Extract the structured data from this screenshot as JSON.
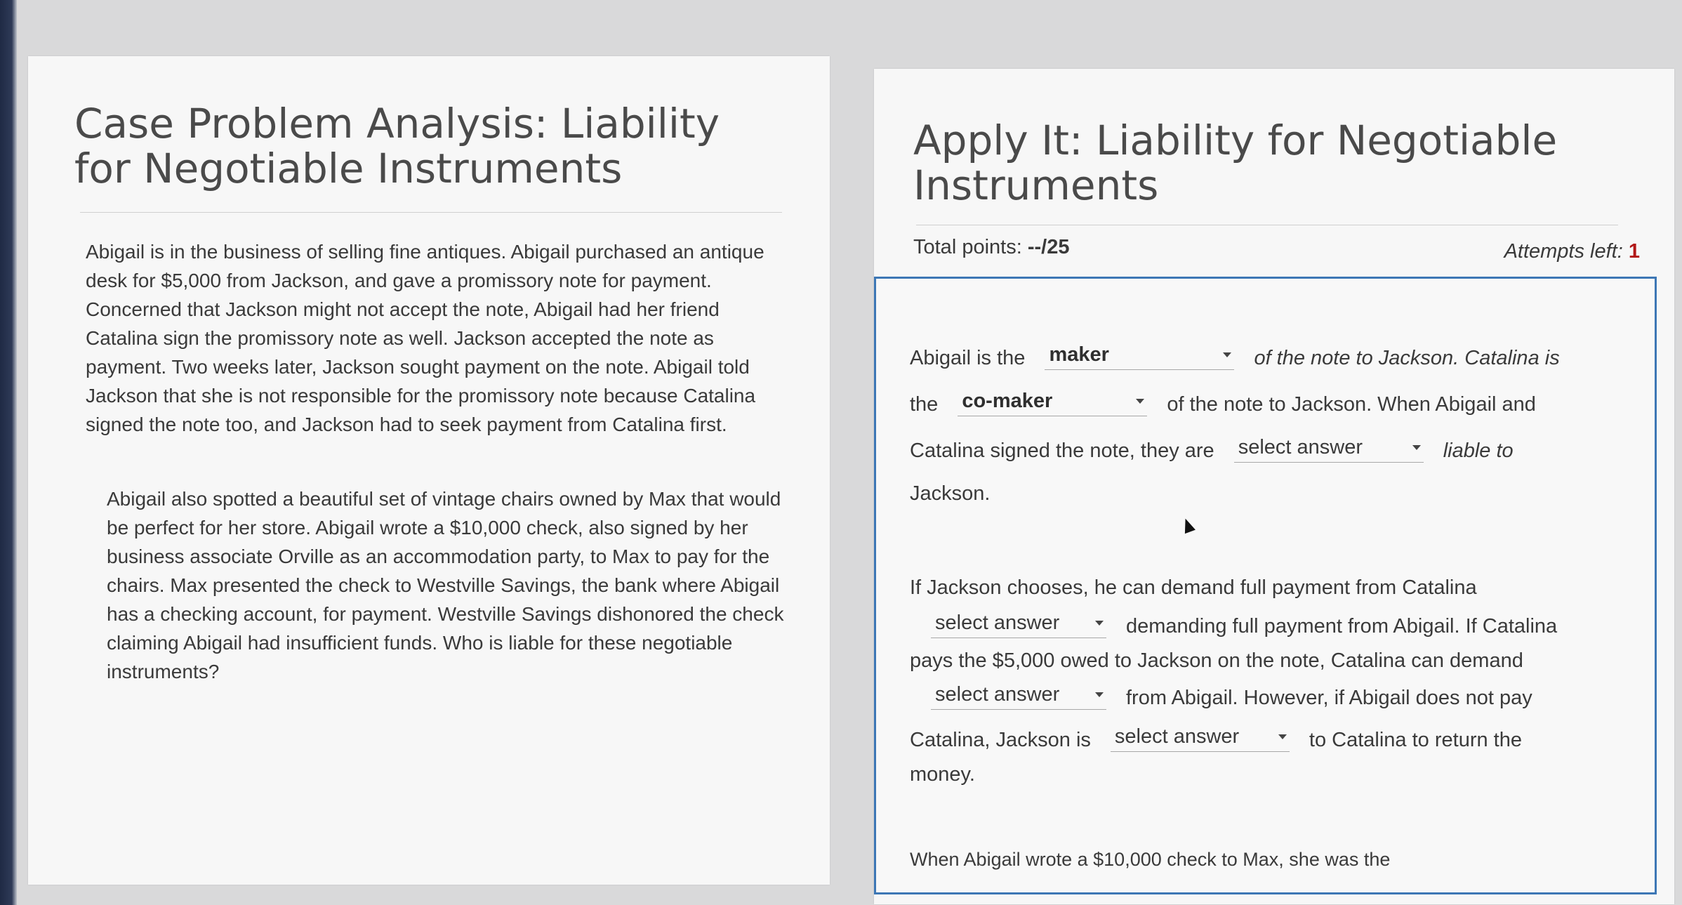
{
  "left_panel": {
    "title": "Case Problem Analysis: Liability for Negotiable Instruments",
    "paragraph_1": "Abigail is in the business of selling fine antiques. Abigail purchased an antique desk for $5,000 from Jackson, and gave a promissory note for payment. Concerned that Jackson might not accept the note, Abigail had her friend Catalina sign the promissory note as well. Jackson accepted the note as payment. Two weeks later, Jackson sought payment on the note. Abigail told Jackson that she is not responsible for the promissory note because Catalina signed the note too, and Jackson had to seek payment from Catalina first.",
    "paragraph_2": "Abigail also spotted a beautiful set of vintage chairs owned by Max that would be perfect for her store. Abigail wrote a $10,000 check, also signed by her business associate Orville as an accommodation party, to Max to pay for the chairs. Max presented the check to Westville Savings, the bank where Abigail has a checking account, for payment. Westville Savings dishonored the check claiming Abigail had insufficient funds. Who is liable for these negotiable instruments?"
  },
  "right_panel": {
    "title": "Apply It: Liability for Negotiable Instruments",
    "total_points_label": "Total points: ",
    "total_points_value": "--/25",
    "attempts_label": "Attempts left: ",
    "attempts_value": "1",
    "q1": {
      "text_1": "Abigail is the",
      "dropdown_1": "maker",
      "text_2": "of the note to Jackson. Catalina is",
      "text_3": "the",
      "dropdown_2": "co-maker",
      "text_4": "of the note to Jackson. When Abigail and",
      "text_5": "Catalina signed the note, they are",
      "dropdown_3": "select answer",
      "text_6": "liable to",
      "text_7": "Jackson."
    },
    "q2": {
      "text_1": "If Jackson chooses, he can demand full payment from Catalina",
      "dropdown_1": "select answer",
      "text_2": "demanding full payment from Abigail. If Catalina",
      "text_3": "pays the $5,000 owed to Jackson on the note, Catalina can demand",
      "dropdown_2": "select answer",
      "text_4": "from Abigail. However, if Abigail does not pay",
      "text_5": "Catalina, Jackson is",
      "dropdown_3": "select answer",
      "text_6": "to Catalina to return the",
      "text_7": "money."
    },
    "q3": {
      "text_1": "When Abigail wrote a $10,000 check to Max, she was the"
    }
  }
}
